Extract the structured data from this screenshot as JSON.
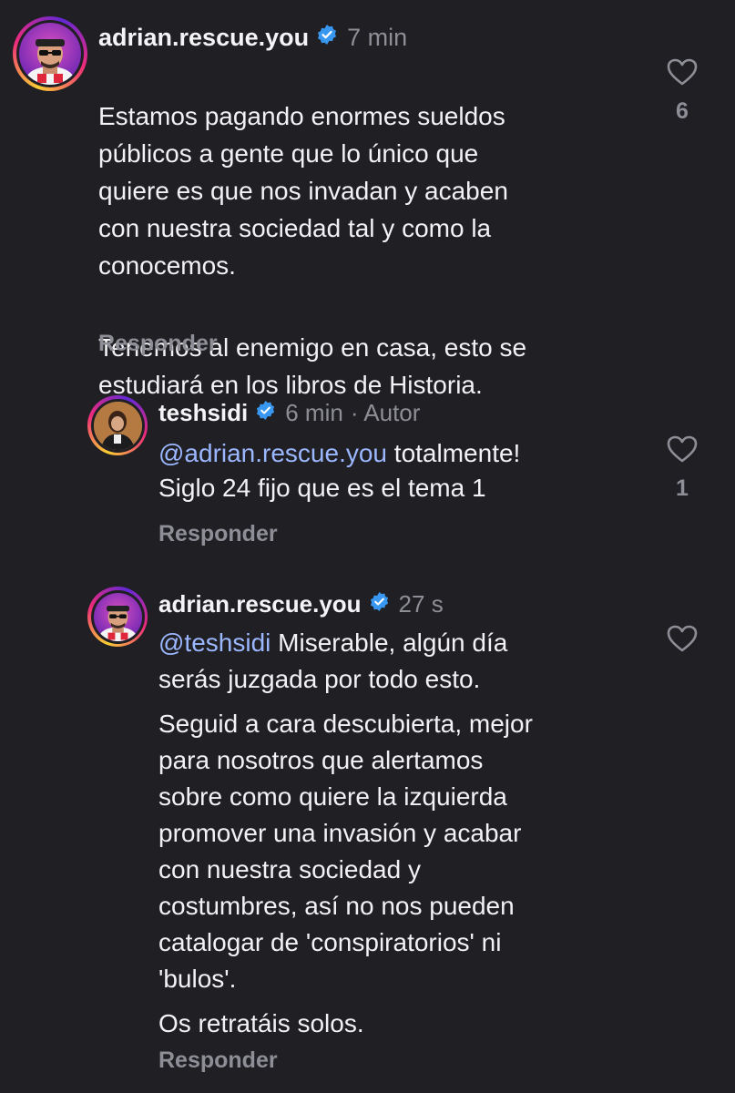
{
  "comments": [
    {
      "username": "adrian.rescue.you",
      "verified": true,
      "time": "7 min",
      "author_tag": "",
      "paragraphs": [
        "Estamos pagando enormes sueldos\npúblicos a gente que lo único que\nquiere es que nos invadan y acaben\ncon nuestra sociedad tal y como la\nconocemos.",
        "Tenemos al enemigo en casa, esto se\nestudiará en los libros de Historia."
      ],
      "reply_label": "Responder",
      "likes": "6",
      "avatar": "cartoon-man-avatar"
    },
    {
      "username": "teshsidi",
      "verified": true,
      "time": "6 min",
      "author_tag": "· Autor",
      "mention": "@adrian.rescue.you",
      "paragraphs": [
        " totalmente!\nSiglo 24 fijo que es el tema 1"
      ],
      "reply_label": "Responder",
      "likes": "1",
      "avatar": "woman-photo-avatar"
    },
    {
      "username": "adrian.rescue.you",
      "verified": true,
      "time": "27 s",
      "author_tag": "",
      "mention": "@teshsidi",
      "paragraphs": [
        " Miserable, algún día\nserás juzgada por todo esto.",
        "Seguid a cara descubierta, mejor\npara nosotros que alertamos\nsobre como quiere la izquierda\npromover una invasión y acabar\ncon nuestra sociedad y\ncostumbres, así no nos pueden\ncatalogar de 'conspiratorios' ni\n'bulos'.",
        "Os retratáis solos."
      ],
      "reply_label": "Responder",
      "likes": "",
      "avatar": "cartoon-man-avatar"
    }
  ],
  "colors": {
    "background": "#1f1f24",
    "text": "#f2f2f4",
    "muted": "#8e8e96",
    "mention": "#9bb7ff",
    "verified": "#3897f0"
  }
}
